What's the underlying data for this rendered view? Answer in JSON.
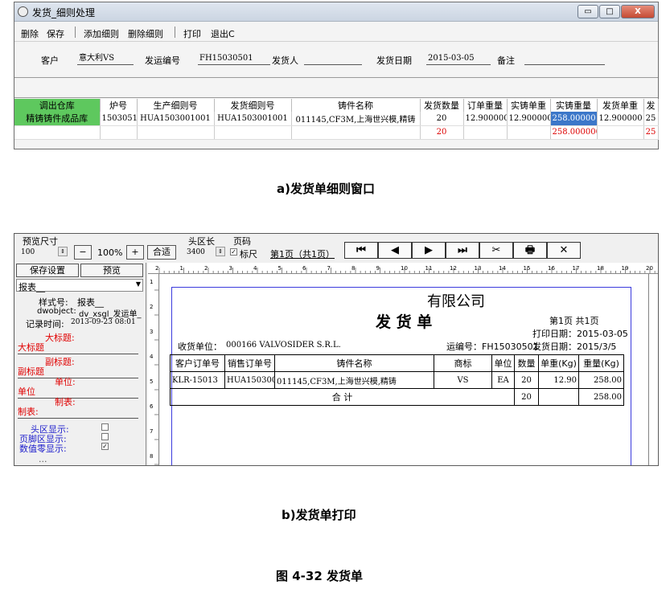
{
  "window_a": {
    "title": "发货_细则处理",
    "controls": {
      "minimize": "▭",
      "maximize": "□",
      "close": "X"
    },
    "menu": [
      "删除",
      "保存",
      "添加细则",
      "删除细则",
      "打印",
      "退出C"
    ],
    "fields": {
      "customer_label": "客户",
      "customer_value": "意大利VS",
      "ship_no_label": "发运编号",
      "ship_no_value": "FH15030501",
      "shipper_label": "发货人",
      "shipper_value": "",
      "ship_date_label": "发货日期",
      "ship_date_value": "2015-03-05",
      "remark_label": "备注",
      "remark_value": ""
    },
    "grid": {
      "headers": [
        "调出仓库",
        "炉号",
        "生产细则号",
        "发货细则号",
        "铸件名称",
        "发货数量",
        "订单重量",
        "实铸单重",
        "实铸重量",
        "发货单重",
        "发"
      ],
      "row": [
        "精铸铸件成品库",
        "1503051",
        "HUA1503001001",
        "HUA1503001001",
        "011145,CF3M,上海世兴模,精铸",
        "20",
        "12.900000",
        "12.900000",
        "258.00000",
        "12.900000",
        "25"
      ],
      "summary": {
        "qty": "20",
        "weight": "258.000000",
        "last": "25"
      }
    }
  },
  "caption_a": "a)发货单细则窗口",
  "window_b": {
    "toolbar": {
      "preview_size_label": "预览尺寸",
      "zoom_value": "100",
      "minus": "−",
      "zoom_percent": "100%",
      "plus": "+",
      "fit": "合适",
      "header_len_label": "头区长",
      "header_len_value": "3400",
      "ruler_label": "标尺",
      "page_code_label": "页码",
      "page_info": "第1页（共1页）",
      "nav": [
        "⏮",
        "◀",
        "▶",
        "⏭",
        "✂",
        "🖶",
        "✕"
      ]
    },
    "left_panel": {
      "save_settings": "保存设置",
      "preview": "预览",
      "report_select": "报表__",
      "style_label": "样式号:",
      "style_value": "报表__",
      "dwobject_label": "dwobject:",
      "dwobject_value": "dv_xsgl_发运单_",
      "record_time_label": "记录时间:",
      "record_time_value": "2013-09-23 08:01",
      "big_title_label": "大标题:",
      "big_title_value": "大标题",
      "sub_title_label": "副标题:",
      "sub_title_value": "副标题",
      "unit_label": "单位:",
      "unit_value": "单位",
      "maker_label": "制表:",
      "maker_value": "制表:",
      "header_show": "头区显示:",
      "footer_show": "页脚区显示:",
      "zero_show": "数值零显示:",
      "zero_show_checked": "✓",
      "truncated": "..."
    },
    "ruler_nums": [
      "2",
      "1",
      "2",
      "3",
      "4",
      "5",
      "6",
      "7",
      "8",
      "9",
      "10",
      "11",
      "12",
      "13",
      "14",
      "15",
      "16",
      "17",
      "18",
      "19",
      "20"
    ],
    "vruler_nums": [
      "1",
      "2",
      "3",
      "4",
      "5",
      "6",
      "7",
      "8"
    ],
    "report": {
      "company": "有限公司",
      "doc_title": "发 货 单",
      "page": "第1页 共1页",
      "print_date": "打印日期：2015-03-05",
      "ship_date": "发货日期：2015/3/5",
      "receiver_label": "收货单位：",
      "receiver_value": "000166 VALVOSIDER S.R.L.",
      "ship_no": "运编号：FH15030501",
      "headers": [
        "客户订单号",
        "销售订单号",
        "铸件名称",
        "商标",
        "单位",
        "数量",
        "单重(Kg)",
        "重量(Kg)"
      ],
      "row": [
        "KLR-15013",
        "HUA1503001",
        "011145,CF3M,上海世兴模,精铸",
        "VS",
        "EA",
        "20",
        "12.90",
        "258.00"
      ],
      "total_label": "合    计",
      "total_qty": "20",
      "total_weight": "258.00"
    }
  },
  "caption_b": "b)发货单打印",
  "figure_caption": "图 4-32  发货单"
}
